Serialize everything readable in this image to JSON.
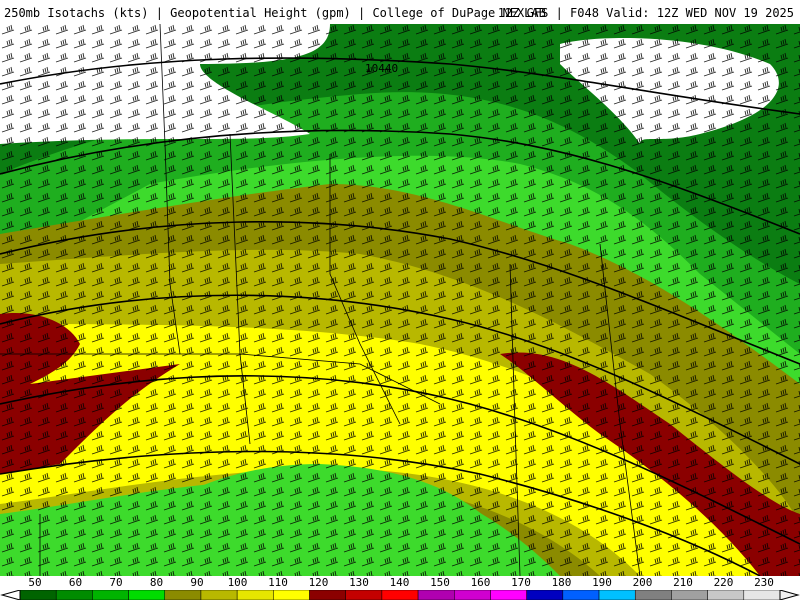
{
  "header": {
    "left": "250mb Isotachs (kts) | Geopotential Height (gpm) | College of DuPage NEXLAB",
    "right": "12Z GFS | F048 Valid: 12Z WED NOV 19 2025"
  },
  "map": {
    "contour_label": "10440"
  },
  "scale": {
    "labels": [
      "50",
      "60",
      "70",
      "80",
      "90",
      "100",
      "110",
      "120",
      "130",
      "140",
      "150",
      "160",
      "170",
      "180",
      "190",
      "200",
      "210",
      "220",
      "230"
    ],
    "colors": [
      "#006400",
      "#008c00",
      "#00b400",
      "#00dc00",
      "#8b8b00",
      "#b8b800",
      "#e6e600",
      "#ffff00",
      "#8b0000",
      "#c40000",
      "#ff0000",
      "#b000b0",
      "#d000d0",
      "#ff00ff",
      "#0000c0",
      "#0060ff",
      "#00c0ff",
      "#808080",
      "#a0a0a0",
      "#c8c8c8",
      "#e6e6e6"
    ]
  }
}
